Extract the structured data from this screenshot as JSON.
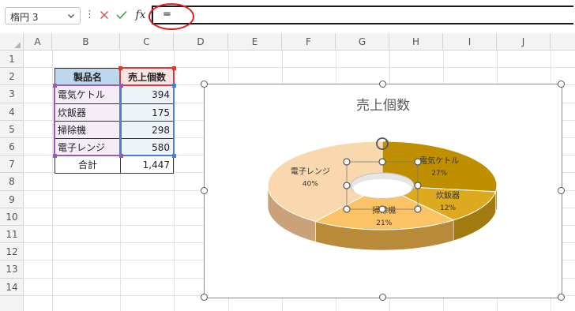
{
  "formula_bar": {
    "name_box": "楕円 3",
    "formula": "="
  },
  "columns": [
    "A",
    "B",
    "C",
    "D",
    "E",
    "F",
    "G",
    "H",
    "I",
    "J"
  ],
  "rows": [
    "1",
    "2",
    "3",
    "4",
    "5",
    "6",
    "7",
    "8",
    "9",
    "10",
    "11",
    "12",
    "13",
    "14"
  ],
  "table": {
    "header_name": "製品名",
    "header_count": "売上個数",
    "items": [
      {
        "name": "電気ケトル",
        "count": "394"
      },
      {
        "name": "炊飯器",
        "count": "175"
      },
      {
        "name": "掃除機",
        "count": "298"
      },
      {
        "name": "電子レンジ",
        "count": "580"
      }
    ],
    "total_label": "合計",
    "total_value": "1,447"
  },
  "chart_data": {
    "type": "pie",
    "title": "売上個数",
    "categories": [
      "電気ケトル",
      "炊飯器",
      "掃除機",
      "電子レンジ"
    ],
    "values": [
      394,
      175,
      298,
      580
    ],
    "percent_labels": [
      "27%",
      "12%",
      "21%",
      "40%"
    ],
    "colors": [
      "#bf8f00",
      "#ddaa1f",
      "#fcc366",
      "#f9d8ae"
    ],
    "side_colors": [
      "#7a5a00",
      "#a17a10",
      "#b88a3a",
      "#c9a27a"
    ],
    "style": "3d-doughnut"
  },
  "icons": {
    "name_box_arrow": "chevron-down-icon",
    "cancel": "x-icon",
    "enter": "check-icon",
    "fx": "function-icon",
    "rotate": "rotate-icon"
  },
  "accent": {
    "annotation_circle": "#e21b1b"
  }
}
